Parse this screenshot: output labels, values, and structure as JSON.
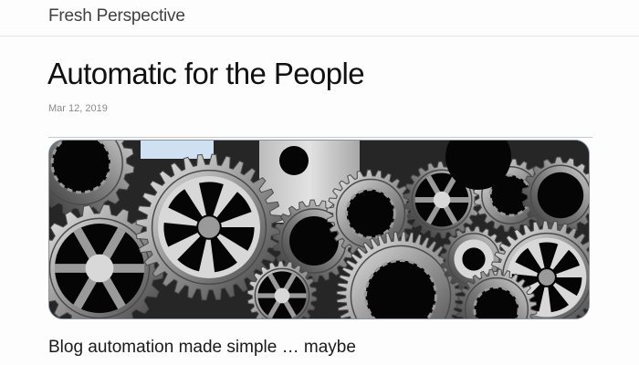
{
  "header": {
    "site_title": "Fresh Perspective"
  },
  "post": {
    "title": "Automatic for the People",
    "date": "Mar 12, 2019",
    "subtitle": "Blog automation made simple … maybe"
  },
  "hero_image": {
    "subject": "gears-image",
    "palette": {
      "background": "#2a2a2a",
      "steel_light": "#d8d8d8",
      "steel_mid": "#9a9a9a",
      "steel_dark": "#4a4a4a",
      "hole": "#050505",
      "sky_blue": "#cfe0f2"
    }
  }
}
